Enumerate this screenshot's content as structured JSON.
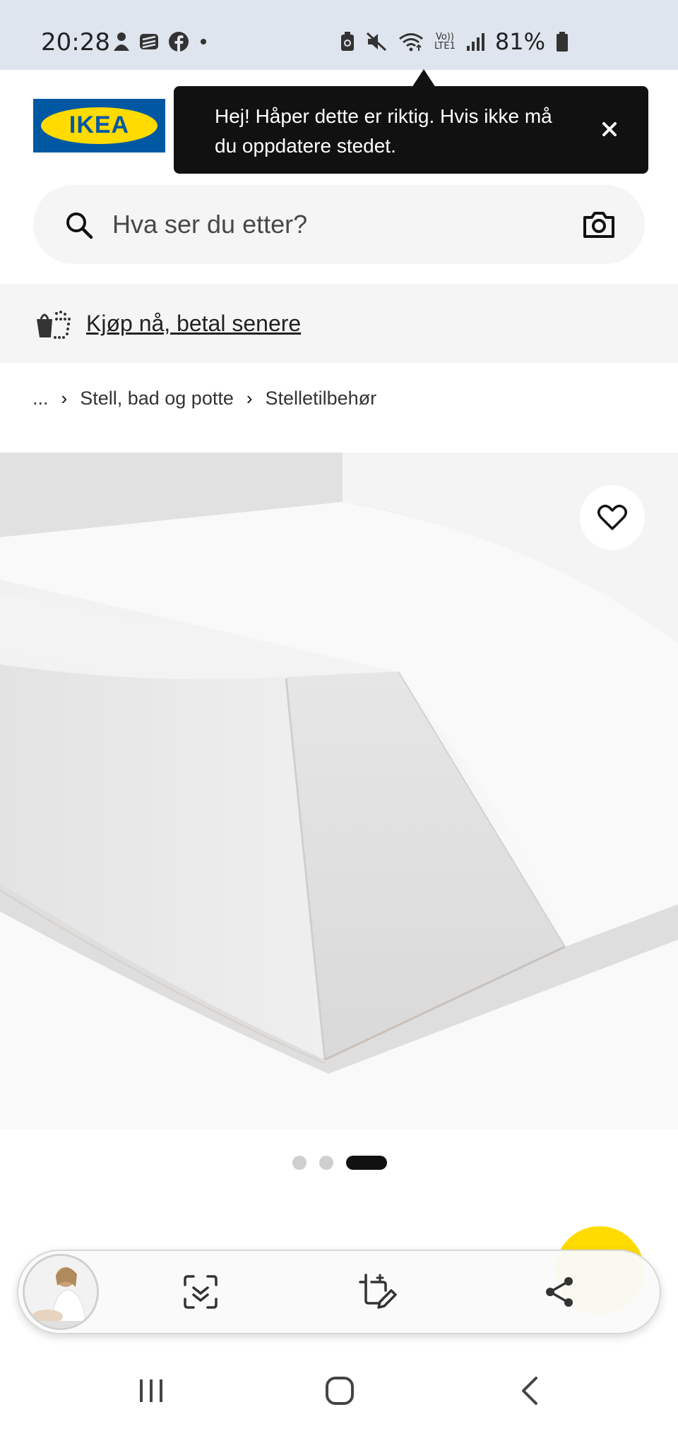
{
  "status_bar": {
    "time": "20:28",
    "battery_percent": "81%",
    "network_label_top": "Vo))",
    "network_label_bottom": "LTE1"
  },
  "header": {
    "logo_text": "IKEA",
    "brand_colors": {
      "blue": "#0058a3",
      "yellow": "#ffdb00"
    }
  },
  "tooltip": {
    "text": "Hej! Håper dette er riktig. Hvis ikke må du oppdatere stedet.",
    "close_icon": "close-icon"
  },
  "search": {
    "placeholder": "Hva ser du etter?",
    "search_icon": "search-icon",
    "camera_icon": "camera-icon"
  },
  "promo": {
    "label": "Kjøp nå, betal senere",
    "icon": "basket-icon"
  },
  "breadcrumb": {
    "items": [
      "...",
      "Stell, bad og potte",
      "Stelletilbehør"
    ]
  },
  "gallery": {
    "favorite_icon": "heart-icon",
    "slide_count": 3,
    "active_slide": 3
  },
  "screenshot_toolbar": {
    "buttons": [
      "scan-icon",
      "crop-edit-icon",
      "share-icon"
    ]
  },
  "navbar": {
    "buttons": [
      "recents-icon",
      "home-icon",
      "back-icon"
    ]
  }
}
